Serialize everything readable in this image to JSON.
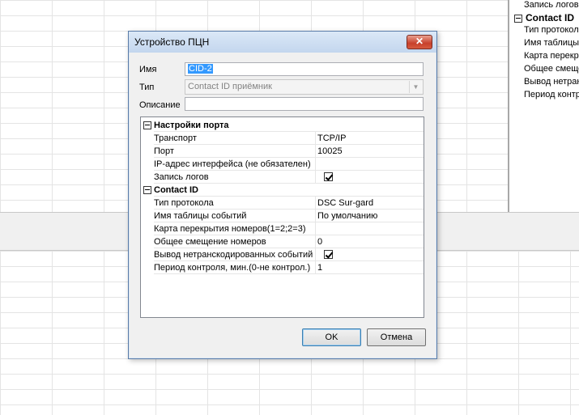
{
  "background": {
    "right_panel_rows": [
      {
        "text": "Запись логов",
        "group": false
      },
      {
        "text": "Contact ID",
        "group": true
      },
      {
        "text": "Тип протокола",
        "group": false
      },
      {
        "text": "Имя таблицы",
        "group": false
      },
      {
        "text": "Карта перекр",
        "group": false
      },
      {
        "text": "Общее смеще",
        "group": false
      },
      {
        "text": "Вывод нетран",
        "group": false
      },
      {
        "text": "Период контр",
        "group": false
      }
    ]
  },
  "dialog": {
    "title": "Устройство ПЦН",
    "close_glyph": "✕",
    "fields": {
      "name_label": "Имя",
      "name_value": "CID-2",
      "type_label": "Тип",
      "type_value": "Contact ID приёмник",
      "description_label": "Описание",
      "description_value": ""
    },
    "grid": {
      "categories": [
        {
          "title": "Настройки порта",
          "rows": [
            {
              "name": "Транспорт",
              "value": "TCP/IP",
              "checkbox": false
            },
            {
              "name": "Порт",
              "value": "10025",
              "checkbox": false
            },
            {
              "name": "IP-адрес интерфейса (не обязателен)",
              "value": "",
              "checkbox": false
            },
            {
              "name": "Запись логов",
              "value": "",
              "checkbox": true
            }
          ]
        },
        {
          "title": "Contact ID",
          "rows": [
            {
              "name": "Тип протокола",
              "value": "DSC Sur-gard",
              "checkbox": false
            },
            {
              "name": "Имя таблицы событий",
              "value": "По умолчанию",
              "checkbox": false
            },
            {
              "name": "Карта перекрытия номеров(1=2;2=3)",
              "value": "",
              "checkbox": false
            },
            {
              "name": "Общее смещение номеров",
              "value": "0",
              "checkbox": false
            },
            {
              "name": "Вывод нетранскодированных событий",
              "value": "",
              "checkbox": true
            },
            {
              "name": "Период контроля, мин.(0-не контрол.)",
              "value": "1",
              "checkbox": false
            }
          ]
        }
      ]
    },
    "buttons": {
      "ok_label": "OK",
      "cancel_label": "Отмена"
    }
  }
}
